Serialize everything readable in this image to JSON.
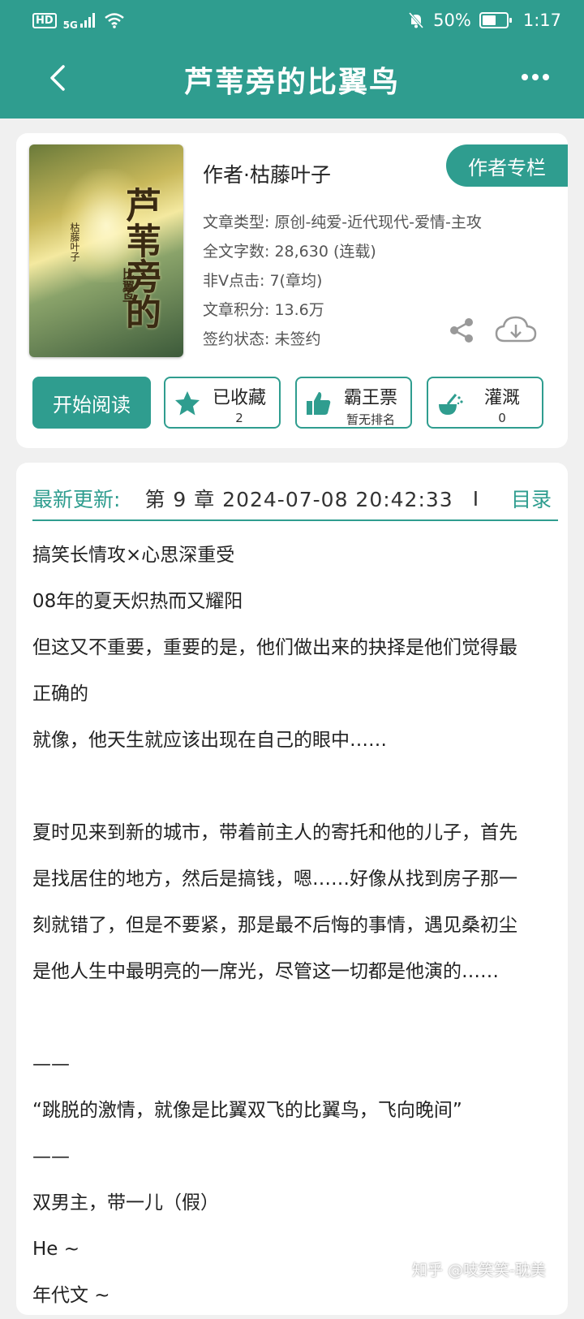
{
  "status_bar": {
    "hd": "HD",
    "network": "5G",
    "battery_percent": "50%",
    "battery_level": 0.5,
    "time": "1:17"
  },
  "header": {
    "title": "芦苇旁的比翼鸟",
    "back_icon": "chevron-left-icon",
    "more_icon": "more-dots-icon"
  },
  "book": {
    "cover_title": "芦苇旁的",
    "cover_subtitle": "比翼鸟",
    "cover_author": "枯藤叶子",
    "author_line": "作者·枯藤叶子",
    "author_column_button": "作者专栏",
    "meta": [
      "文章类型: 原创-纯爱-近代现代-爱情-主攻",
      "全文字数: 28,630 (连载)",
      "非V点击: 7(章均)",
      "文章积分: 13.6万",
      "签约状态: 未签约"
    ]
  },
  "actions": {
    "start_reading": "开始阅读",
    "collect": {
      "label": "已收藏",
      "count": "2"
    },
    "ticket": {
      "label": "霸王票",
      "sub": "暂无排名"
    },
    "nutrient": {
      "label": "灌溉",
      "count": "0"
    }
  },
  "update": {
    "label": "最新更新:",
    "info": "第 9 章  2024-07-08 20:42:33",
    "separator": "I",
    "toc": "目录"
  },
  "description": [
    "搞笑长情攻×心思深重受",
    "08年的夏天炽热而又耀阳",
    "但这又不重要，重要的是，他们做出来的抉择是他们觉得最",
    "正确的",
    "就像，他天生就应该出现在自己的眼中……",
    "",
    "夏时见来到新的城市，带着前主人的寄托和他的儿子，首先",
    "是找居住的地方，然后是搞钱，嗯……好像从找到房子那一",
    "刻就错了，但是不要紧，那是最不后悔的事情，遇见桑初尘",
    "是他人生中最明亮的一席光，尽管这一切都是他演的……",
    "",
    "——",
    "“跳脱的激情，就像是比翼双飞的比翼鸟，飞向晚间”",
    "——",
    "双男主，带一儿（假）",
    "He ~",
    "年代文 ~"
  ],
  "watermark": "知乎 @吱笑笑-耽美",
  "colors": {
    "accent": "#2f9d8f"
  }
}
